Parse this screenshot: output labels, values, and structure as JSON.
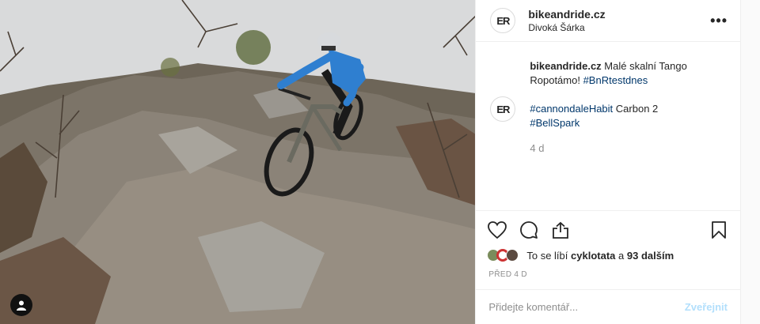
{
  "post": {
    "username": "bikeandride.cz",
    "location": "Divoká Šárka",
    "avatar_initials": "ER",
    "more_icon": "ellipsis-icon",
    "caption": {
      "author": "bikeandride.cz",
      "text_part1": "Malé skalní Tango Ropotámo!",
      "hashtag1": "#BnRtestdnes",
      "hashtag2": "#cannondaleHabit",
      "text_part2": "Carbon 2",
      "hashtag3": "#BellSpark",
      "time": "4 d"
    },
    "actions": {
      "like_icon": "heart-icon",
      "comment_icon": "comment-icon",
      "share_icon": "share-icon",
      "save_icon": "bookmark-icon"
    },
    "likes": {
      "prefix": "To se líbí",
      "user": "cyklotata",
      "middle": "a",
      "count_text": "93 dalším"
    },
    "posted_ago": "PŘED 4 D",
    "comment_input": {
      "placeholder": "Přidejte komentář...",
      "submit_label": "Zveřejnit"
    }
  },
  "colors": {
    "hashtag": "#00376b",
    "publish_disabled": "#b2dffc",
    "secondary_text": "#8e8e8e"
  }
}
